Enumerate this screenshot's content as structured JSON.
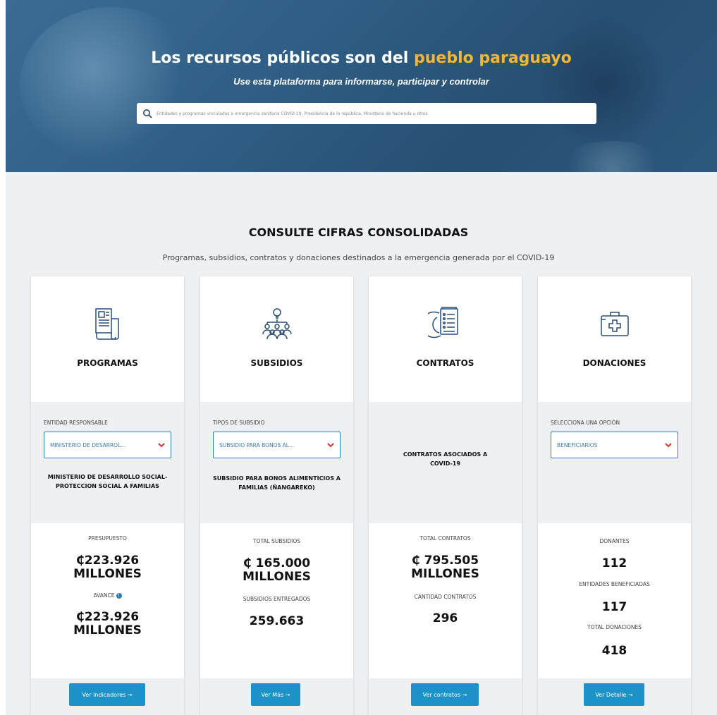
{
  "hero": {
    "title_part1": "Los recursos públicos son del",
    "title_part2": "pueblo paraguayo",
    "subtitle": "Use esta plataforma para informarse, participar y controlar",
    "search_placeholder": "Entidades y programas vinculados a emergencia sanitaria COVID-19, Presidencia de la república, Ministerio de hacienda u otros",
    "search_value": ""
  },
  "section": {
    "title": "CONSULTE CIFRAS CONSOLIDADAS",
    "subtitle": "Programas, subsidios, contratos y donaciones destinados a la emergencia generada por el COVID-19"
  },
  "cards": [
    {
      "title": "PROGRAMAS",
      "icon": "newspaper-icon",
      "select_label": "ENTIDAD RESPONSABLE",
      "select_value": "MINISTERIO DE DESARROL...",
      "description": "MINISTERIO DE DESARROLLO SOCIAL-PROTECCION SOCIAL A FAMILIAS",
      "stats": [
        {
          "label": "PRESUPUESTO",
          "value": "₵223.926 MILLONES"
        },
        {
          "label": "AVANCE",
          "value": "₵223.926 MILLONES"
        }
      ],
      "button": "Ver Indicadores →"
    },
    {
      "title": "SUBSIDIOS",
      "icon": "people-idea-icon",
      "select_label": "TIPOS DE SUBSIDIO",
      "select_value": "SUBSIDIO PARA BONOS AL...",
      "description": "SUBSIDIO PARA BONOS ALIMENTICIOS A FAMILIAS (ÑANGAREKO)",
      "stats": [
        {
          "label": "TOTAL SUBSIDIOS",
          "value": "₵ 165.000 MILLONES"
        },
        {
          "label": "SUBSIDIOS ENTREGADOS",
          "value": "259.663"
        }
      ],
      "button": "Ver Más →"
    },
    {
      "title": "CONTRATOS",
      "icon": "contract-document-icon",
      "description": "CONTRATOS ASOCIADOS A COVID-19",
      "stats": [
        {
          "label": "TOTAL CONTRATOS",
          "value": "₵ 795.505 MILLONES"
        },
        {
          "label": "CANTIDAD CONTRATOS",
          "value": "296"
        }
      ],
      "button": "Ver contratos →"
    },
    {
      "title": "DONACIONES",
      "icon": "medical-kit-icon",
      "select_label": "SELECCIONA UNA OPCIÓN",
      "select_value": "BENEFICIARIOS",
      "stats": [
        {
          "label": "DONANTES",
          "value": "112"
        },
        {
          "label": "ENTIDADES BENEFICIADAS",
          "value": "117"
        },
        {
          "label": "TOTAL DONACIONES",
          "value": "418"
        }
      ],
      "button": "Ver Detalle →"
    }
  ],
  "colors": {
    "hero_bg": "#2f5d83",
    "highlight": "#f5b731",
    "section_bg": "#eef0f2",
    "button": "#1c92c8",
    "select_border": "#2a7fb4",
    "chevron": "#d9342b"
  }
}
